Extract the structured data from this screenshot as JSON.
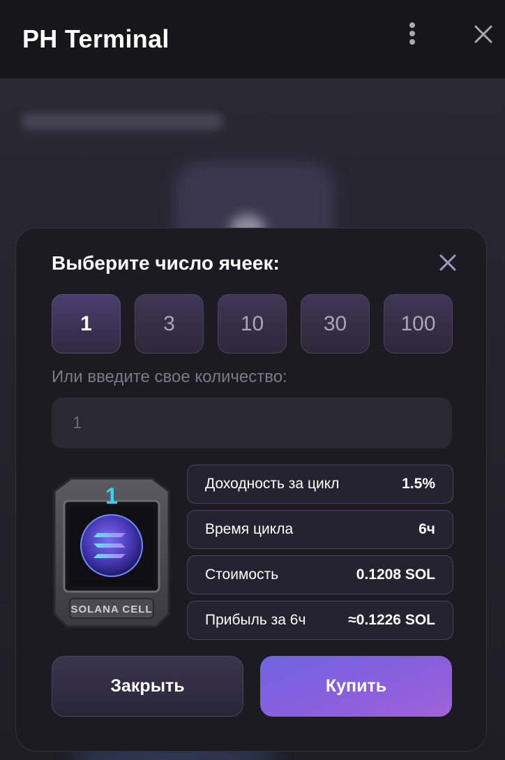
{
  "header": {
    "title": "PH Terminal"
  },
  "modal": {
    "title": "Выберите число ячеек:",
    "quantity_options": [
      "1",
      "3",
      "10",
      "30",
      "100"
    ],
    "selected_quantity": "1",
    "custom_label": "Или введите свое количество:",
    "custom_input_placeholder": "1",
    "cell": {
      "number": "1",
      "label": "SOLANA CELL"
    },
    "info": [
      {
        "label": "Доходность за цикл",
        "value": "1.5%"
      },
      {
        "label": "Время цикла",
        "value": "6ч"
      },
      {
        "label": "Стоимость",
        "value": "0.1208 SOL"
      },
      {
        "label": "Прибыль за 6ч",
        "value": "≈0.1226 SOL"
      }
    ],
    "close_label": "Закрыть",
    "buy_label": "Купить"
  },
  "colors": {
    "accent_start": "#7064e0",
    "accent_end": "#a062d8",
    "cell_number": "#3fd0ee"
  }
}
